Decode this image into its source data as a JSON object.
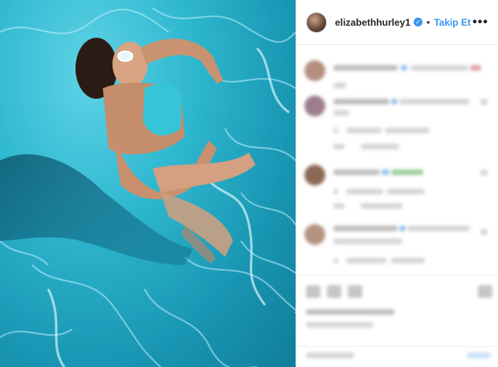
{
  "post": {
    "username": "elizabethhurley1",
    "follow_label": "Takip Et",
    "separator": "•",
    "more_label": "•••",
    "verified_glyph": "✓"
  },
  "icons": [
    "avatar",
    "verified-badge-icon",
    "more-options-icon",
    "like-icon",
    "comment-icon",
    "share-icon",
    "bookmark-icon"
  ],
  "colors": {
    "accent": "#3897f0",
    "water": "#2fb8d0",
    "text": "#262626"
  }
}
